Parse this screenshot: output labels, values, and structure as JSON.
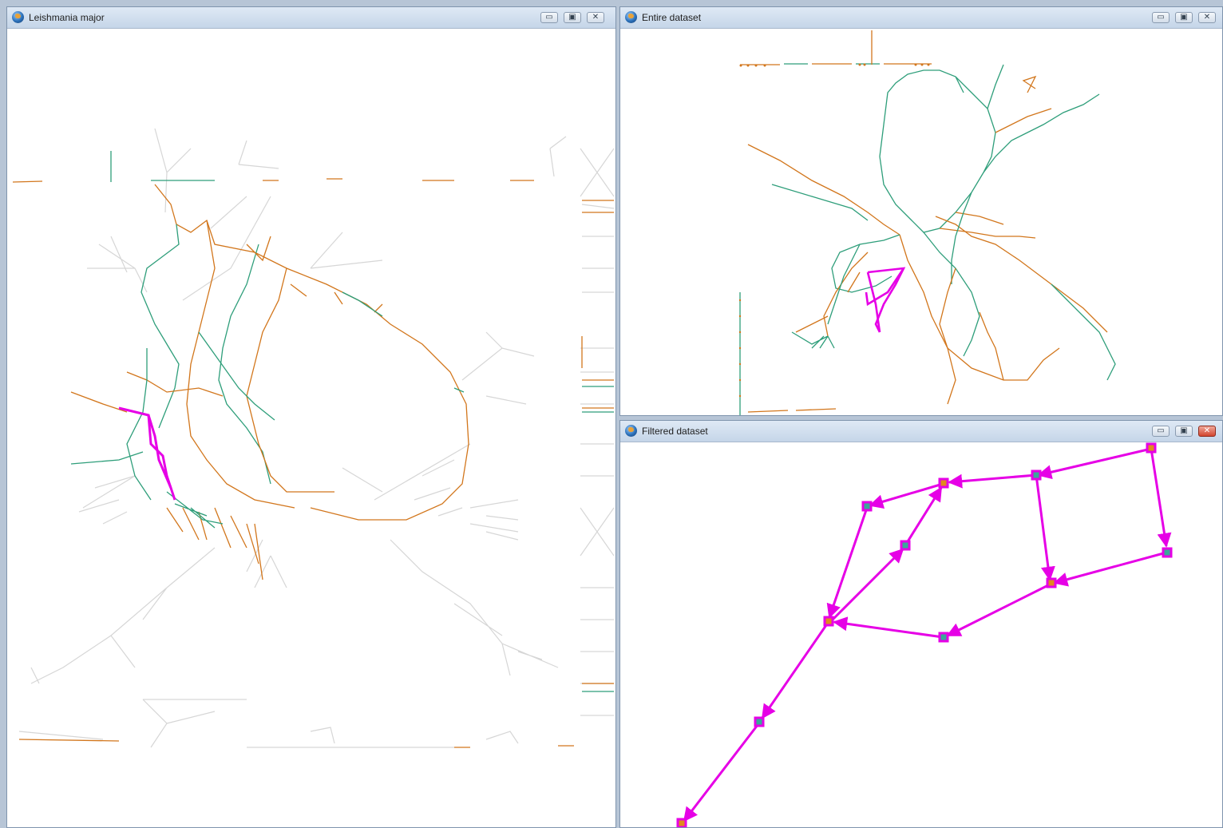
{
  "windows": {
    "leishmania": {
      "title": "Leishmania major"
    },
    "entire": {
      "title": "Entire dataset"
    },
    "filtered": {
      "title": "Filtered dataset"
    }
  },
  "controls": {
    "minimize": "▭",
    "maximize": "▣",
    "close": "✕"
  },
  "colors": {
    "highlight_path": "#e600e6",
    "edge_green": "#2e9e7a",
    "edge_orange": "#d2761c",
    "edge_faded": "#d4d4d4",
    "node_fill_teal": "#3aa89a",
    "node_fill_orange": "#e08a1e"
  },
  "icons": {
    "app": "network-app-icon"
  }
}
